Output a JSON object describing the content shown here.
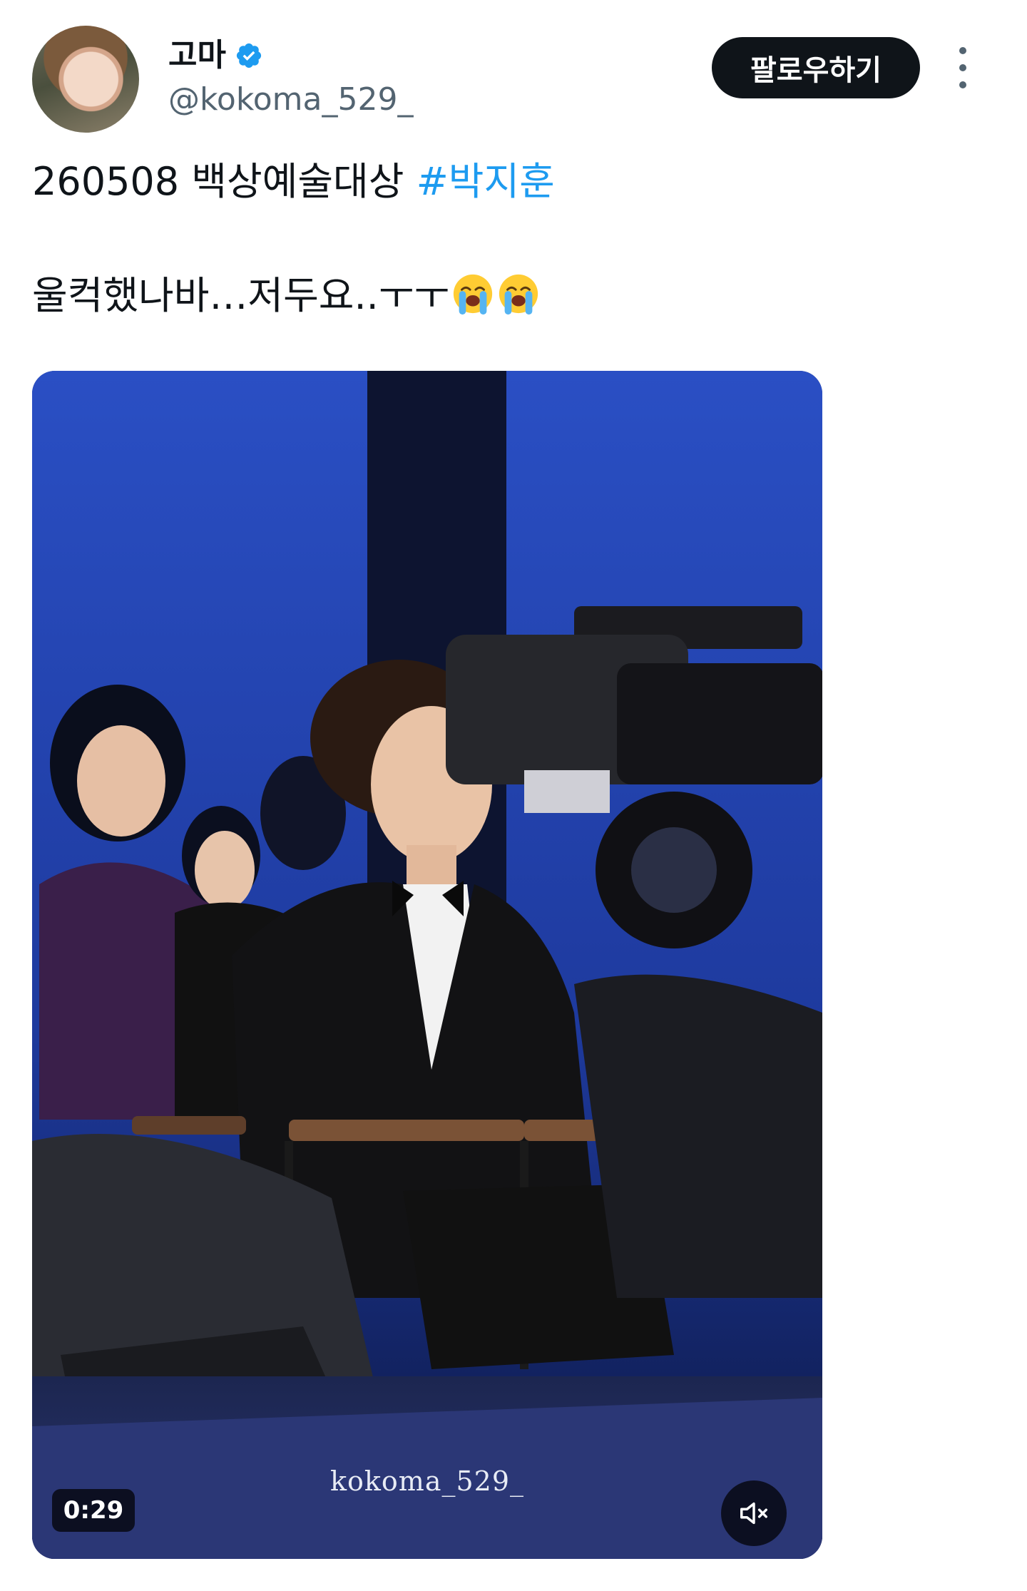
{
  "author": {
    "display_name": "고마",
    "handle": "@kokoma_529_",
    "verified": true
  },
  "actions": {
    "follow_label": "팔로우하기",
    "more_icon": "more-vertical-icon"
  },
  "tweet": {
    "line1_text": "260508 백상예술대상 ",
    "line1_hashtag": "#박지훈",
    "line2_text": "울컥했나바…저두요..ㅜㅜ",
    "line2_emojis": [
      "loudly-crying-face-icon",
      "loudly-crying-face-icon"
    ]
  },
  "media": {
    "type": "video",
    "watermark": "kokoma_529_",
    "duration": "0:29",
    "muted": true,
    "mute_icon": "speaker-muted-icon"
  },
  "colors": {
    "text": "#0f1419",
    "secondary": "#536471",
    "link": "#1d9bf0",
    "button_bg": "#0f1419",
    "verified": "#1d9bf0"
  }
}
